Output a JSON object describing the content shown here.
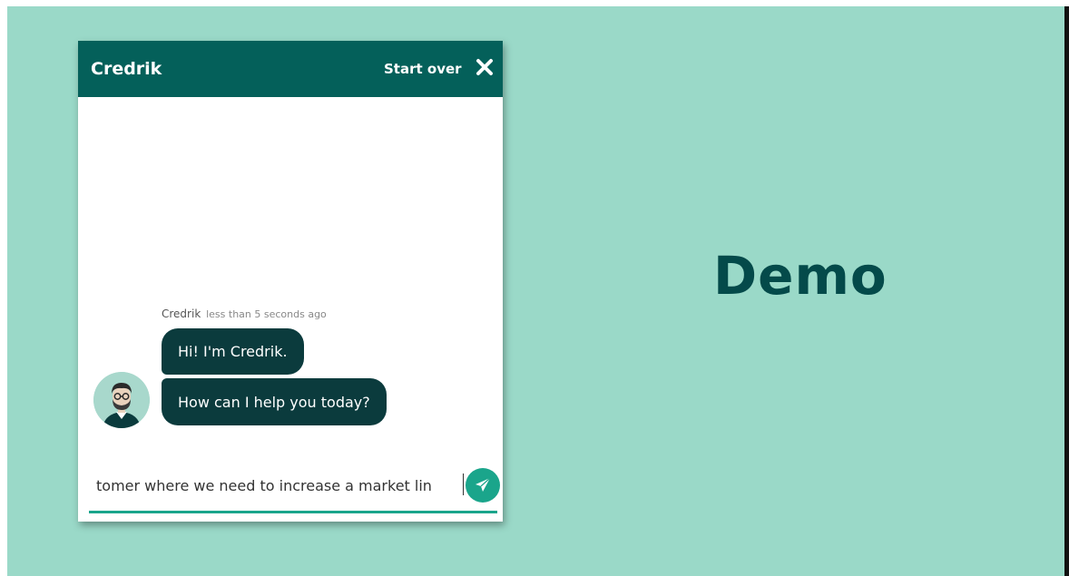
{
  "chat": {
    "title": "Credrik",
    "start_over_label": "Start over",
    "close_icon": "close-icon",
    "messages": {
      "sender": "Credrik",
      "timestamp": "less than 5 seconds ago",
      "items": [
        {
          "text": "Hi! I'm Credrik."
        },
        {
          "text": "How can I help you today?"
        }
      ]
    },
    "input": {
      "value": "tomer where we need to increase a market lin",
      "send_icon": "paper-plane-icon"
    }
  },
  "slide": {
    "title": "Demo"
  },
  "colors": {
    "background": "#9ad9c8",
    "header": "#04605a",
    "bubble": "#0b3b3d",
    "accent": "#1aa58b",
    "demo_text": "#044a4a"
  }
}
